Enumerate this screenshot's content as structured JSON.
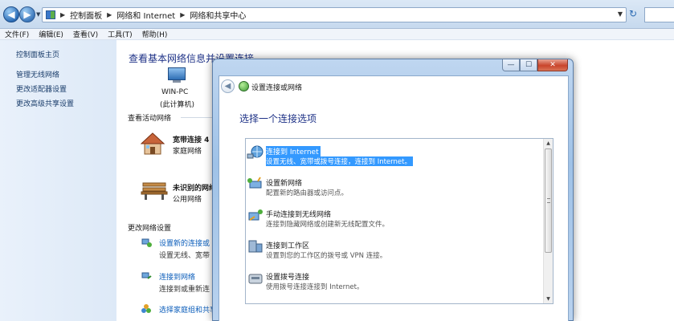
{
  "explorer": {
    "breadcrumb": [
      "控制面板",
      "网络和 Internet",
      "网络和共享中心"
    ],
    "menu": [
      "文件(F)",
      "编辑(E)",
      "查看(V)",
      "工具(T)",
      "帮助(H)"
    ]
  },
  "sidebar": {
    "title": "控制面板主页",
    "links": [
      "管理无线网络",
      "更改适配器设置",
      "更改高级共享设置"
    ]
  },
  "main": {
    "heading": "查看基本网络信息并设置连接",
    "computer_name": "WIN-PC",
    "computer_sub": "(此计算机)",
    "active_networks_label": "查看活动网络",
    "networks": [
      {
        "name": "宽带连接  4",
        "type": "家庭网络"
      },
      {
        "name": "未识别的网络",
        "type": "公用网络"
      }
    ],
    "change_settings_label": "更改网络设置",
    "settings": [
      {
        "link": "设置新的连接或",
        "desc": "设置无线、宽带"
      },
      {
        "link": "连接到网络",
        "desc": "连接到或重新连"
      },
      {
        "link": "选择家庭组和共享",
        "desc": ""
      }
    ]
  },
  "dialog": {
    "title": "设置连接或网络",
    "heading": "选择一个连接选项",
    "close_symbol": "✕",
    "min_symbol": "—",
    "max_symbol": "☐",
    "options": [
      {
        "title": "连接到 Internet",
        "desc": "设置无线、宽带或拨号连接，连接到 Internet。",
        "selected": true
      },
      {
        "title": "设置新网络",
        "desc": "配置新的路由器或访问点。",
        "selected": false
      },
      {
        "title": "手动连接到无线网络",
        "desc": "连接到隐藏网络或创建新无线配置文件。",
        "selected": false
      },
      {
        "title": "连接到工作区",
        "desc": "设置到您的工作区的拨号或 VPN 连接。",
        "selected": false
      },
      {
        "title": "设置拨号连接",
        "desc": "使用拨号连接连接到 Internet。",
        "selected": false
      }
    ]
  }
}
